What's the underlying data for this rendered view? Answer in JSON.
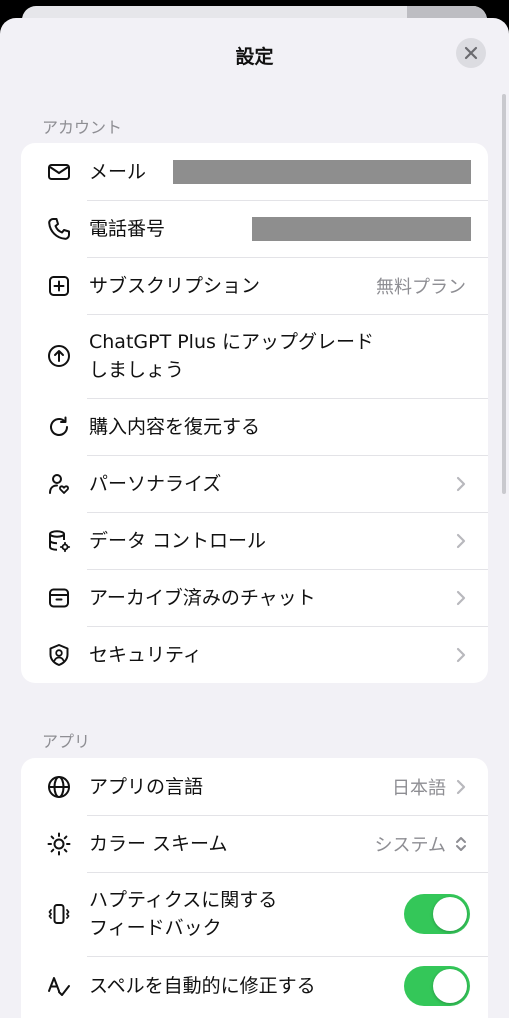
{
  "sheet": {
    "title": "設定"
  },
  "account": {
    "header": "アカウント",
    "rows": [
      {
        "label": "メール",
        "icon": "mail-icon"
      },
      {
        "label": "電話番号",
        "icon": "phone-icon"
      },
      {
        "label": "サブスクリプション",
        "value": "無料プラン",
        "icon": "plus-square-icon"
      },
      {
        "label": "ChatGPT Plus にアップグレード\nしましょう",
        "icon": "arrow-up-circle-icon"
      },
      {
        "label": "購入内容を復元する",
        "icon": "refresh-icon"
      },
      {
        "label": "パーソナライズ",
        "icon": "person-heart-icon"
      },
      {
        "label": "データ コントロール",
        "icon": "database-gear-icon"
      },
      {
        "label": "アーカイブ済みのチャット",
        "icon": "archive-icon"
      },
      {
        "label": "セキュリティ",
        "icon": "shield-person-icon"
      }
    ]
  },
  "app": {
    "header": "アプリ",
    "rows": [
      {
        "label": "アプリの言語",
        "value": "日本語",
        "icon": "globe-icon"
      },
      {
        "label": "カラー スキーム",
        "value": "システム",
        "icon": "sun-icon"
      },
      {
        "label": "ハプティクスに関する\nフィードバック",
        "icon": "vibration-icon",
        "toggle": true
      },
      {
        "label": "スペルを自動的に修正する",
        "icon": "spellcheck-icon",
        "toggle": true
      }
    ]
  },
  "colors": {
    "accent": "#34c759",
    "background": "#f2f1f6",
    "card": "#ffffff",
    "secondary_text": "#8e8e93"
  }
}
